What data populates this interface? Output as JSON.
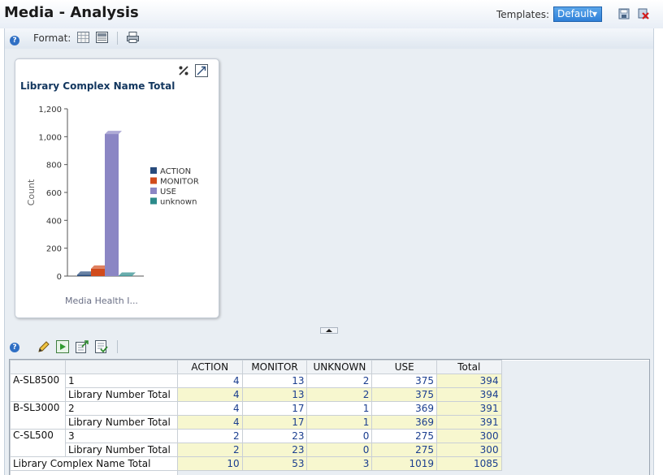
{
  "header": {
    "title": "Media - Analysis",
    "templates_label": "Templates:",
    "template_selected": "Default"
  },
  "toolbar": {
    "format_label": "Format:"
  },
  "chart": {
    "title": "Library Complex Name Total",
    "ylabel": "Count",
    "xlabel": "Media Health I...",
    "y_ticks": [
      "1,200",
      "1,000",
      "800",
      "600",
      "400",
      "200",
      "0"
    ],
    "legend": [
      "ACTION",
      "MONITOR",
      "USE",
      "unknown"
    ]
  },
  "chart_data": {
    "type": "bar",
    "title": "Library Complex Name Total",
    "xlabel": "Media Health I...",
    "ylabel": "Count",
    "ylim": [
      0,
      1200
    ],
    "categories": [
      "Media Health I..."
    ],
    "series": [
      {
        "name": "ACTION",
        "values": [
          10
        ],
        "color": "#284b7c"
      },
      {
        "name": "MONITOR",
        "values": [
          53
        ],
        "color": "#d14b1c"
      },
      {
        "name": "USE",
        "values": [
          1019
        ],
        "color": "#8b86c4"
      },
      {
        "name": "unknown",
        "values": [
          3
        ],
        "color": "#2b8a8a"
      }
    ],
    "legend": "right",
    "grid": false
  },
  "table": {
    "columns": [
      "ACTION",
      "MONITOR",
      "UNKNOWN",
      "USE",
      "Total"
    ],
    "rows": [
      {
        "group": "A-SL8500",
        "label": "1",
        "values": [
          "4",
          "13",
          "2",
          "375",
          "394"
        ],
        "total_row": false
      },
      {
        "group": "",
        "label": "Library Number Total",
        "values": [
          "4",
          "13",
          "2",
          "375",
          "394"
        ],
        "total_row": true
      },
      {
        "group": "B-SL3000",
        "label": "2",
        "values": [
          "4",
          "17",
          "1",
          "369",
          "391"
        ],
        "total_row": false
      },
      {
        "group": "",
        "label": "Library Number Total",
        "values": [
          "4",
          "17",
          "1",
          "369",
          "391"
        ],
        "total_row": true
      },
      {
        "group": "C-SL500",
        "label": "3",
        "values": [
          "2",
          "23",
          "0",
          "275",
          "300"
        ],
        "total_row": false
      },
      {
        "group": "",
        "label": "Library Number Total",
        "values": [
          "2",
          "23",
          "0",
          "275",
          "300"
        ],
        "total_row": true
      }
    ],
    "grand_total": {
      "label": "Library Complex Name Total",
      "values": [
        "10",
        "53",
        "3",
        "1019",
        "1085"
      ]
    }
  }
}
